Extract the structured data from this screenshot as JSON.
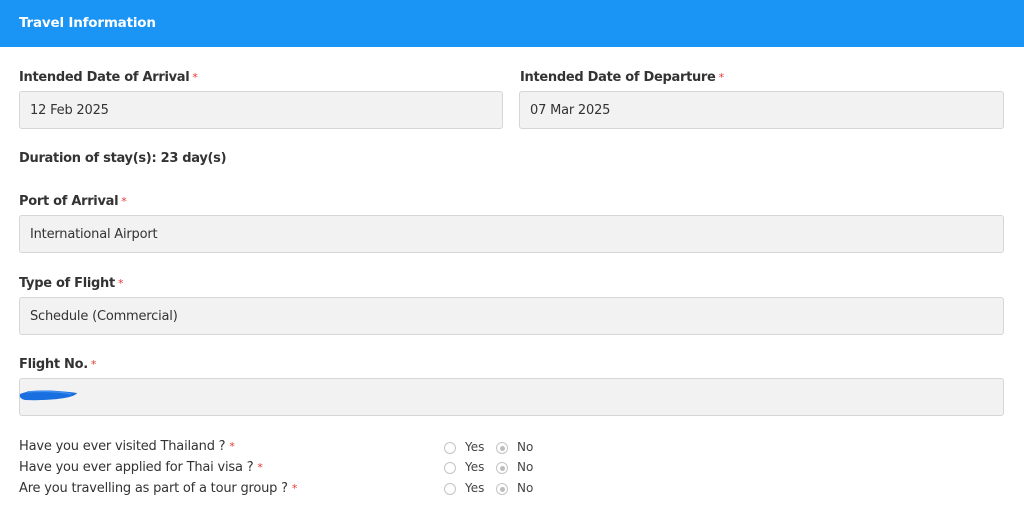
{
  "header": {
    "title": "Travel Information"
  },
  "arrival_date": {
    "label": "Intended Date of Arrival",
    "required": "*",
    "value": "12 Feb 2025"
  },
  "departure_date": {
    "label": "Intended Date of Departure",
    "required": "*",
    "value": "07 Mar 2025"
  },
  "duration": {
    "text": "Duration of stay(s): 23 day(s)"
  },
  "port_of_arrival": {
    "label": "Port of Arrival",
    "required": "*",
    "value": "International Airport"
  },
  "flight_type": {
    "label": "Type of Flight",
    "required": "*",
    "value": "Schedule (Commercial)"
  },
  "flight_no": {
    "label": "Flight No.",
    "required": "*",
    "value": "",
    "redaction_color": "#1a6fe0"
  },
  "questions": [
    {
      "label": "Have you ever visited Thailand ?",
      "required": "*",
      "yes": "Yes",
      "no": "No",
      "selected": "No"
    },
    {
      "label": "Have you ever applied for Thai visa ?",
      "required": "*",
      "yes": "Yes",
      "no": "No",
      "selected": "No"
    },
    {
      "label": "Are you travelling as part of a tour group ?",
      "required": "*",
      "yes": "Yes",
      "no": "No",
      "selected": "No"
    }
  ],
  "colors": {
    "header_bg": "#1a94f5",
    "required": "#e53935",
    "field_bg": "#f2f2f2"
  }
}
